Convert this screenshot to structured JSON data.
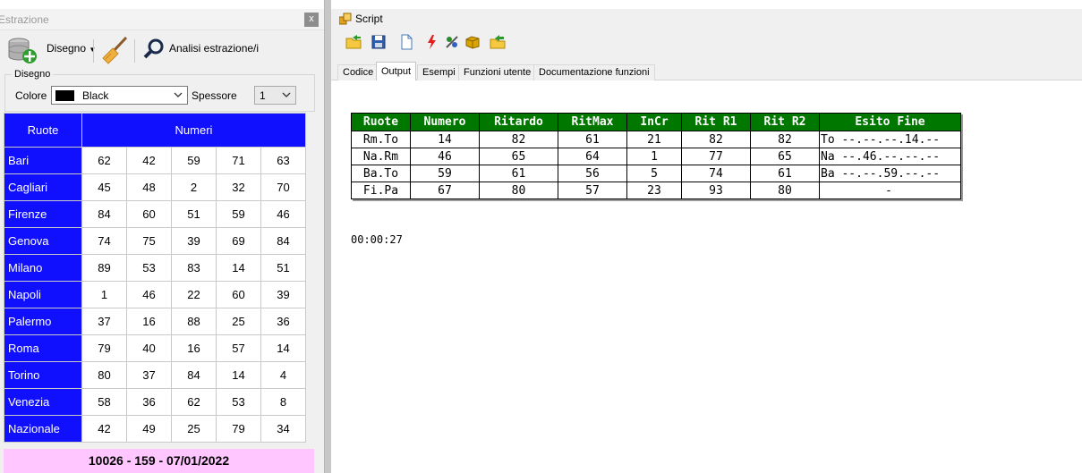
{
  "left_panel": {
    "title": "Estrazione",
    "close_label": "x",
    "toolbar": {
      "disegno_label": "Disegno",
      "analisi_label": "Analisi estrazione/i"
    },
    "group": {
      "label": "Disegno",
      "colore_label": "Colore",
      "colore_value": "Black",
      "colore_swatch": "#000000",
      "spessore_label": "Spessore",
      "spessore_value": "1"
    },
    "table": {
      "header_wheel": "Ruote",
      "header_numbers": "Numeri",
      "rows": [
        {
          "wheel": "Bari",
          "numbers": [
            "62",
            "42",
            "59",
            "71",
            "63"
          ]
        },
        {
          "wheel": "Cagliari",
          "numbers": [
            "45",
            "48",
            "2",
            "32",
            "70"
          ]
        },
        {
          "wheel": "Firenze",
          "numbers": [
            "84",
            "60",
            "51",
            "59",
            "46"
          ]
        },
        {
          "wheel": "Genova",
          "numbers": [
            "74",
            "75",
            "39",
            "69",
            "84"
          ]
        },
        {
          "wheel": "Milano",
          "numbers": [
            "89",
            "53",
            "83",
            "14",
            "51"
          ]
        },
        {
          "wheel": "Napoli",
          "numbers": [
            "1",
            "46",
            "22",
            "60",
            "39"
          ]
        },
        {
          "wheel": "Palermo",
          "numbers": [
            "37",
            "16",
            "88",
            "25",
            "36"
          ]
        },
        {
          "wheel": "Roma",
          "numbers": [
            "79",
            "40",
            "16",
            "57",
            "14"
          ]
        },
        {
          "wheel": "Torino",
          "numbers": [
            "80",
            "37",
            "84",
            "14",
            "4"
          ]
        },
        {
          "wheel": "Venezia",
          "numbers": [
            "58",
            "36",
            "62",
            "53",
            "8"
          ]
        },
        {
          "wheel": "Nazionale",
          "numbers": [
            "42",
            "49",
            "25",
            "79",
            "34"
          ]
        }
      ]
    },
    "draw_info": "10026 - 159 - 07/01/2022"
  },
  "script_panel": {
    "title": "Script",
    "tabs": [
      "Codice",
      "Output",
      "Esempi",
      "Funzioni utente",
      "Documentazione funzioni"
    ],
    "active_tab": "Output",
    "result_table": {
      "headers": [
        "Ruote",
        "Numero",
        "Ritardo",
        "RitMax",
        "InCr",
        "Rit R1",
        "Rit R2",
        "Esito Fine"
      ],
      "rows": [
        [
          "Rm.To",
          "14",
          "82",
          "61",
          "21",
          "82",
          "82",
          "To --.--.--.14.--"
        ],
        [
          "Na.Rm",
          "46",
          "65",
          "64",
          "1",
          "77",
          "65",
          "Na --.46.--.--.--"
        ],
        [
          "Ba.To",
          "59",
          "61",
          "56",
          "5",
          "74",
          "61",
          "Ba --.--.59.--.--"
        ],
        [
          "Fi.Pa",
          "67",
          "80",
          "57",
          "23",
          "93",
          "80",
          "-"
        ]
      ]
    },
    "timer": "00:00:27"
  },
  "colors": {
    "wheel_blue": "#1010ff",
    "header_green": "#007800",
    "draw_pink": "#ffc6ff"
  }
}
